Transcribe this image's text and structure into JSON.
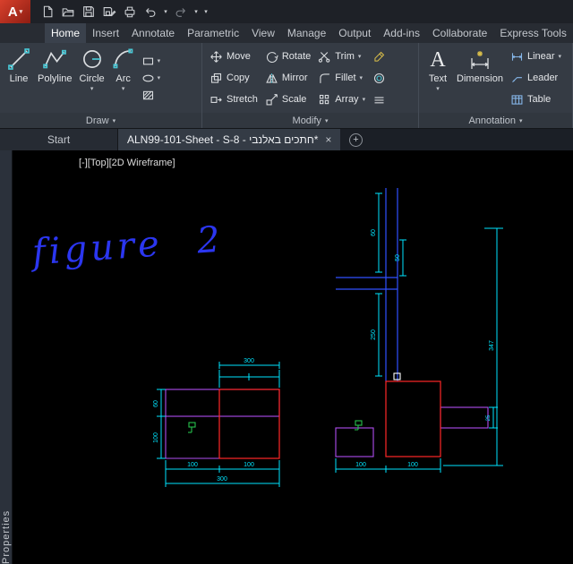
{
  "titlebar": {
    "logo_letter": "A",
    "qat_icon_names": [
      "new-file-icon",
      "open-folder-icon",
      "save-icon",
      "save-as-icon",
      "plot-icon",
      "undo-icon",
      "redo-icon",
      "qat-customize-icon"
    ]
  },
  "ui": {
    "dropdown_glyph": "▾",
    "close_glyph": "×",
    "plus_glyph": "+"
  },
  "ribbon": {
    "tabs": [
      "Home",
      "Insert",
      "Annotate",
      "Parametric",
      "View",
      "Manage",
      "Output",
      "Add-ins",
      "Collaborate",
      "Express Tools"
    ],
    "active_tab": "Home",
    "panels": {
      "draw": {
        "label": "Draw",
        "big": [
          "Line",
          "Polyline",
          "Circle",
          "Arc"
        ]
      },
      "modify": {
        "label": "Modify",
        "col1": [
          "Move",
          "Copy",
          "Stretch"
        ],
        "col2": [
          "Rotate",
          "Mirror",
          "Scale"
        ],
        "col3": [
          "Trim",
          "Fillet",
          "Array"
        ]
      },
      "annotation": {
        "label": "Annotation",
        "text": "Text",
        "text_icon_glyph": "A",
        "dimension": "Dimension",
        "small": [
          "Linear",
          "Leader",
          "Table"
        ]
      }
    }
  },
  "file_tabs": {
    "start": "Start",
    "document": "ALN99-101-Sheet - S-8 - חתכים באלנבי*"
  },
  "sidebar": {
    "label": "Properties"
  },
  "drawing": {
    "viewport_controls": "[-][Top][2D Wireframe]",
    "handwriting": "figure 2",
    "colors": {
      "cyan": "#00e5ff",
      "red": "#ff2727",
      "blue": "#3050ff",
      "magenta": "#b04ef0",
      "green": "#27c24c",
      "white": "#ffffff",
      "note": "#2b36f0"
    },
    "dims": {
      "top_width": "300",
      "bottom_seg1": "100",
      "bottom_seg2": "100",
      "bottom_total": "300",
      "left_upper": "60",
      "left_lower": "100",
      "right_seg1": "100",
      "right_seg2": "100",
      "right_height": "347",
      "col_upper": "60",
      "col_mid": "50",
      "col_lower": "250",
      "band": "25"
    }
  }
}
